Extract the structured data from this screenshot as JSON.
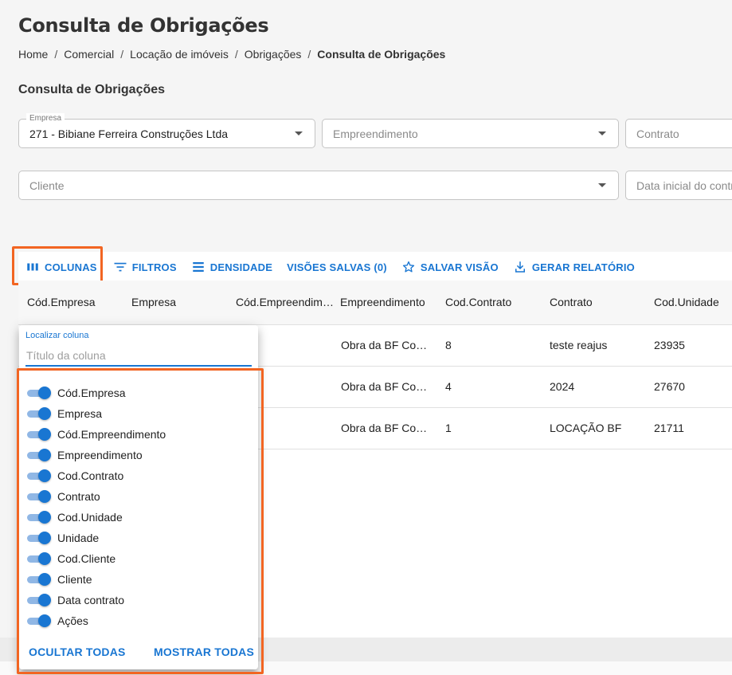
{
  "page": {
    "title": "Consulta de Obrigações"
  },
  "breadcrumb": {
    "items": [
      "Home",
      "Comercial",
      "Locação de imóveis",
      "Obrigações"
    ],
    "current": "Consulta de Obrigações",
    "separator": "/"
  },
  "section": {
    "title": "Consulta de Obrigações"
  },
  "filters": {
    "empresa": {
      "label": "Empresa",
      "value": "271 - Bibiane Ferreira Construções Ltda"
    },
    "empreendimento": {
      "placeholder": "Empreendimento"
    },
    "contrato": {
      "placeholder": "Contrato"
    },
    "cliente": {
      "placeholder": "Cliente"
    },
    "data_inicial": {
      "placeholder": "Data inicial do contrato"
    }
  },
  "toolbar": {
    "colunas": "COLUNAS",
    "filtros": "FILTROS",
    "densidade": "DENSIDADE",
    "visoes_salvas": "VISÕES SALVAS (0)",
    "salvar_visao": "SALVAR VISÃO",
    "gerar_relatorio": "GERAR RELATÓRIO"
  },
  "table": {
    "headers": [
      "Cód.Empresa",
      "Empresa",
      "Cód.Empreendimento",
      "Empreendimento",
      "Cod.Contrato",
      "Contrato",
      "Cod.Unidade"
    ],
    "rows": [
      {
        "empreendimento": "Obra da BF Construções",
        "cod_contrato": "8",
        "contrato": "teste reajus",
        "cod_unidade": "23935"
      },
      {
        "empreendimento": "Obra da BF Construções",
        "cod_contrato": "4",
        "contrato": "2024",
        "cod_unidade": "27670"
      },
      {
        "empreendimento": "Obra da BF Construções",
        "cod_contrato": "1",
        "contrato": "LOCAÇÃO BF",
        "cod_unidade": "21711"
      }
    ]
  },
  "columns_panel": {
    "search_label": "Localizar coluna",
    "search_placeholder": "Título da coluna",
    "columns": [
      {
        "name": "Cód.Empresa",
        "visible": true
      },
      {
        "name": "Empresa",
        "visible": true
      },
      {
        "name": "Cód.Empreendimento",
        "visible": true
      },
      {
        "name": "Empreendimento",
        "visible": true
      },
      {
        "name": "Cod.Contrato",
        "visible": true
      },
      {
        "name": "Contrato",
        "visible": true
      },
      {
        "name": "Cod.Unidade",
        "visible": true
      },
      {
        "name": "Unidade",
        "visible": true
      },
      {
        "name": "Cod.Cliente",
        "visible": true
      },
      {
        "name": "Cliente",
        "visible": true
      },
      {
        "name": "Data contrato",
        "visible": true
      },
      {
        "name": "Ações",
        "visible": true
      }
    ],
    "hide_all": "OCULTAR TODAS",
    "show_all": "MOSTRAR TODAS"
  },
  "colors": {
    "accent": "#1976d2",
    "highlight": "#f26522"
  }
}
